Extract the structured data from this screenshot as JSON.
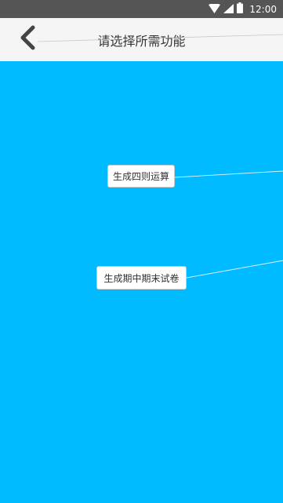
{
  "status_bar": {
    "time": "12:00",
    "icons": [
      "wifi-icon",
      "signal-icon",
      "battery-icon"
    ]
  },
  "toolbar": {
    "back_icon": "chevron-left-icon",
    "title": "请选择所需功能"
  },
  "main": {
    "background_color": "#00bbff",
    "buttons": [
      {
        "label": "生成四则运算"
      },
      {
        "label": "生成期中期末试卷"
      }
    ]
  }
}
